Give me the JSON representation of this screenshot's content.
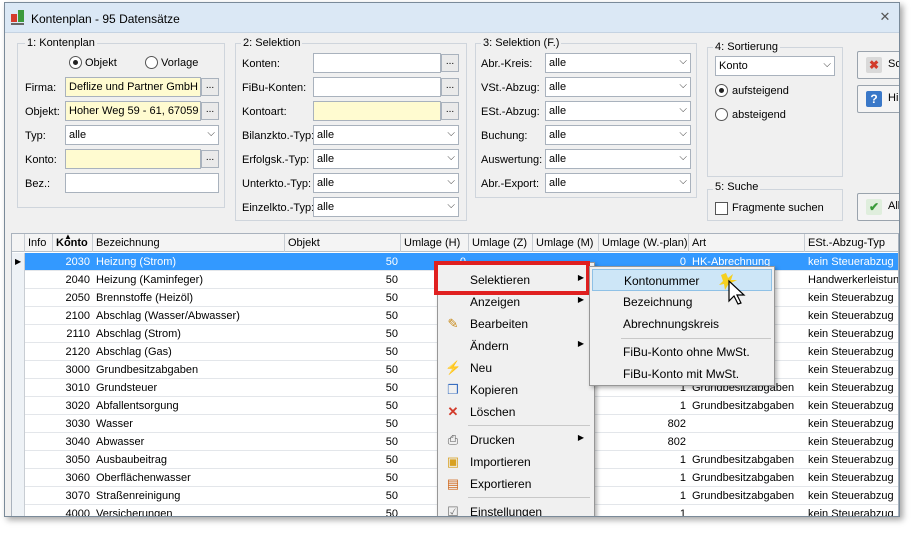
{
  "window": {
    "title": "Kontenplan - 95 Datensätze"
  },
  "kontenplan": {
    "title": "1: Kontenplan",
    "radio_objekt": "Objekt",
    "radio_vorlage": "Vorlage",
    "firma_label": "Firma:",
    "firma_value": "Deflize und Partner GmbH",
    "objekt_label": "Objekt:",
    "objekt_value": "Hoher Weg 59 - 61, 67059",
    "typ_label": "Typ:",
    "typ_value": "alle",
    "konto_label": "Konto:",
    "konto_value": "",
    "bez_label": "Bez.:",
    "bez_value": ""
  },
  "selektion": {
    "title": "2: Selektion",
    "konten_label": "Konten:",
    "fibu_label": "FiBu-Konten:",
    "kontoart_label": "Kontoart:",
    "bilanz_label": "Bilanzkto.-Typ:",
    "bilanz_value": "alle",
    "erfolg_label": "Erfolgsk.-Typ:",
    "erfolg_value": "alle",
    "unter_label": "Unterkto.-Typ:",
    "unter_value": "alle",
    "einzel_label": "Einzelkto.-Typ:",
    "einzel_value": "alle"
  },
  "selektion_f": {
    "title": "3: Selektion (F.)",
    "abr_kreis_label": "Abr.-Kreis:",
    "abr_kreis_value": "alle",
    "vst_label": "VSt.-Abzug:",
    "vst_value": "alle",
    "est_label": "ESt.-Abzug:",
    "est_value": "alle",
    "buchung_label": "Buchung:",
    "buchung_value": "alle",
    "auswertung_label": "Auswertung:",
    "auswertung_value": "alle",
    "export_label": "Abr.-Export:",
    "export_value": "alle"
  },
  "sortierung": {
    "title": "4: Sortierung",
    "value": "Konto",
    "asc": "aufsteigend",
    "desc": "absteigend"
  },
  "suche": {
    "title": "5: Suche",
    "fragmente": "Fragmente suchen"
  },
  "buttons": {
    "schliessen": "Sch",
    "hilfe": "Hi",
    "alle": "All"
  },
  "grid": {
    "headers": [
      "Info",
      "Konto",
      "Bezeichnung",
      "Objekt",
      "Umlage (H)",
      "Umlage (Z)",
      "Umlage (M)",
      "Umlage (W.-plan)",
      "Art",
      "ESt.-Abzug-Typ"
    ],
    "rows": [
      {
        "konto": "2030",
        "bez": "Heizung (Strom)",
        "obj": "50",
        "uh": "0",
        "uw": "0",
        "art": "HK-Abrechnung",
        "est": "kein Steuerabzug"
      },
      {
        "konto": "2040",
        "bez": "Heizung (Kaminfeger)",
        "obj": "50",
        "uh": "",
        "uw": "",
        "art": "",
        "est": "Handwerkerleistung"
      },
      {
        "konto": "2050",
        "bez": "Brennstoffe (Heizöl)",
        "obj": "50",
        "uh": "",
        "uw": "",
        "art": "",
        "est": "kein Steuerabzug"
      },
      {
        "konto": "2100",
        "bez": "Abschlag (Wasser/Abwasser)",
        "obj": "50",
        "uh": "",
        "uw": "",
        "art": "",
        "est": "kein Steuerabzug"
      },
      {
        "konto": "2110",
        "bez": "Abschlag (Strom)",
        "obj": "50",
        "uh": "",
        "uw": "",
        "art": "",
        "est": "kein Steuerabzug"
      },
      {
        "konto": "2120",
        "bez": "Abschlag (Gas)",
        "obj": "50",
        "uh": "",
        "uw": "",
        "art": "",
        "est": "kein Steuerabzug"
      },
      {
        "konto": "3000",
        "bez": "Grundbesitzabgaben",
        "obj": "50",
        "uh": "",
        "uw": "",
        "art": "",
        "est": "kein Steuerabzug"
      },
      {
        "konto": "3010",
        "bez": "Grundsteuer",
        "obj": "50",
        "uh": "",
        "uw": "1",
        "art": "Grundbesitzabgaben",
        "est": "kein Steuerabzug"
      },
      {
        "konto": "3020",
        "bez": "Abfallentsorgung",
        "obj": "50",
        "uh": "",
        "uw": "1",
        "art": "Grundbesitzabgaben",
        "est": "kein Steuerabzug"
      },
      {
        "konto": "3030",
        "bez": "Wasser",
        "obj": "50",
        "uh": "",
        "uw": "802",
        "art": "",
        "est": "kein Steuerabzug"
      },
      {
        "konto": "3040",
        "bez": "Abwasser",
        "obj": "50",
        "uh": "",
        "uw": "802",
        "art": "",
        "est": "kein Steuerabzug"
      },
      {
        "konto": "3050",
        "bez": "Ausbaubeitrag",
        "obj": "50",
        "uh": "",
        "uw": "1",
        "art": "Grundbesitzabgaben",
        "est": "kein Steuerabzug"
      },
      {
        "konto": "3060",
        "bez": "Oberflächenwasser",
        "obj": "50",
        "uh": "",
        "uw": "1",
        "art": "Grundbesitzabgaben",
        "est": "kein Steuerabzug"
      },
      {
        "konto": "3070",
        "bez": "Straßenreinigung",
        "obj": "50",
        "uh": "",
        "uw": "1",
        "art": "Grundbesitzabgaben",
        "est": "kein Steuerabzug"
      },
      {
        "konto": "4000",
        "bez": "Versicherungen",
        "obj": "50",
        "uh": "",
        "uw": "1",
        "art": "",
        "est": "kein Steuerabzug"
      }
    ]
  },
  "context_menu": {
    "items": [
      "Selektieren",
      "Anzeigen",
      "Bearbeiten",
      "Ändern",
      "Neu",
      "Kopieren",
      "Löschen",
      "Drucken",
      "Importieren",
      "Exportieren",
      "Einstellungen"
    ]
  },
  "submenu": {
    "items": [
      "Kontonummer",
      "Bezeichnung",
      "Abrechnungskreis",
      "FiBu-Konto ohne MwSt.",
      "FiBu-Konto mit MwSt."
    ]
  },
  "colors": {
    "selection": "#3399ff",
    "highlight_frame": "#e02020",
    "input_yellow": "#fffbd0"
  }
}
